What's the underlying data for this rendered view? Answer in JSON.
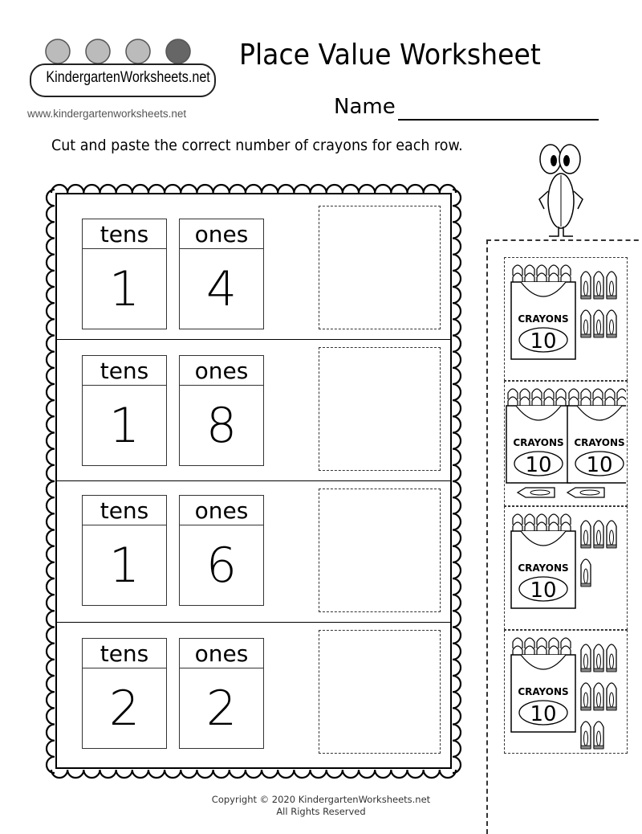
{
  "header": {
    "logo_text": "KindergartenWorksheets.net",
    "logo_url": "www.kindergartenworksheets.net",
    "title": "Place Value Worksheet",
    "name_label": "Name"
  },
  "instructions": "Cut and paste the correct number of crayons for each row.",
  "rows": [
    {
      "tens_label": "tens",
      "ones_label": "ones",
      "tens": "1",
      "ones": "4"
    },
    {
      "tens_label": "tens",
      "ones_label": "ones",
      "tens": "1",
      "ones": "8"
    },
    {
      "tens_label": "tens",
      "ones_label": "ones",
      "tens": "1",
      "ones": "6"
    },
    {
      "tens_label": "tens",
      "ones_label": "ones",
      "tens": "2",
      "ones": "2"
    }
  ],
  "cutouts": [
    {
      "boxes": 1,
      "singles": 6,
      "box_label": "CRAYONS",
      "box_count": "10"
    },
    {
      "boxes": 2,
      "singles": 2,
      "box_label": "CRAYONS",
      "box_count": "10"
    },
    {
      "boxes": 1,
      "singles": 4,
      "box_label": "CRAYONS",
      "box_count": "10"
    },
    {
      "boxes": 1,
      "singles": 8,
      "box_label": "CRAYONS",
      "box_count": "10"
    }
  ],
  "footer": {
    "copyright": "Copyright © 2020 KindergartenWorksheets.net",
    "rights": "All Rights Reserved"
  }
}
